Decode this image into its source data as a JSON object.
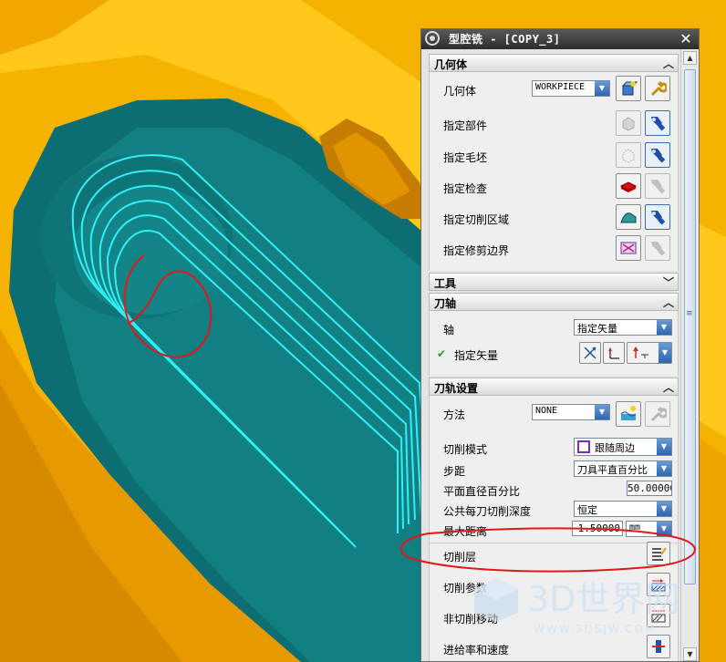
{
  "dialog": {
    "title": "型腔铣 - [COPY_3]",
    "close_symbol": "✕"
  },
  "sections": {
    "geometry": {
      "header": "几何体",
      "geometry_label": "几何体",
      "geometry_value": "WORKPIECE",
      "specify_part": "指定部件",
      "specify_blank": "指定毛坯",
      "specify_check": "指定检查",
      "specify_cut_area": "指定切削区域",
      "specify_trim_boundary": "指定修剪边界"
    },
    "tool": {
      "header": "工具"
    },
    "tool_axis": {
      "header": "刀轴",
      "axis_label": "轴",
      "axis_value": "指定矢量",
      "specify_vector": "指定矢量",
      "specify_vector_checkmark": "✔"
    },
    "path_settings": {
      "header": "刀轨设置",
      "method_label": "方法",
      "method_value": "NONE",
      "cut_pattern_label": "切削模式",
      "cut_pattern_value": "跟随周边",
      "stepover_label": "步距",
      "stepover_value": "刀具平直百分比",
      "flat_diameter_percent_label": "平面直径百分比",
      "flat_diameter_percent_value": "50.00000",
      "common_depth_label": "公共每刀切削深度",
      "common_depth_value": "恒定",
      "max_distance_label": "最大距离",
      "max_distance_value": "1.50000",
      "max_distance_unit": "mm",
      "cut_levels_label": "切削层",
      "cut_params_label": "切削参数",
      "non_cut_moves_label": "非切削移动",
      "feeds_speeds_label": "进给率和速度"
    }
  },
  "watermark": {
    "brand": "3D世界网",
    "url": "WWW.3DSJW.COM"
  },
  "icons": {
    "gear": "gear-icon",
    "flashlight": "flashlight-icon",
    "wrench": "wrench-icon"
  }
}
